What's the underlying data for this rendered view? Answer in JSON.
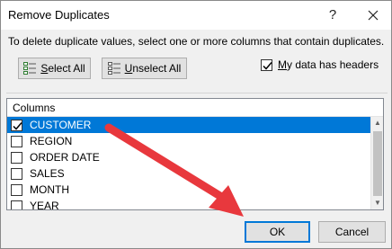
{
  "dialog": {
    "title": "Remove Duplicates",
    "help_label": "?",
    "instructions": "To delete duplicate values, select one or more columns that contain duplicates."
  },
  "toolbar": {
    "select_all_prefix": "",
    "select_all_accel": "S",
    "select_all_rest": "elect All",
    "unselect_all_accel": "U",
    "unselect_all_rest": "nselect All"
  },
  "headers_option": {
    "accel": "M",
    "rest": "y data has headers",
    "checked": true
  },
  "columns_list": {
    "header": "Columns",
    "items": [
      {
        "label": "CUSTOMER",
        "checked": true,
        "selected": true
      },
      {
        "label": "REGION",
        "checked": false,
        "selected": false
      },
      {
        "label": "ORDER DATE",
        "checked": false,
        "selected": false
      },
      {
        "label": "SALES",
        "checked": false,
        "selected": false
      },
      {
        "label": "MONTH",
        "checked": false,
        "selected": false
      },
      {
        "label": "YEAR",
        "checked": false,
        "selected": false
      }
    ]
  },
  "footer": {
    "ok_label": "OK",
    "cancel_label": "Cancel"
  },
  "colors": {
    "selection": "#0078d7",
    "annotation_arrow": "#e8383d"
  }
}
